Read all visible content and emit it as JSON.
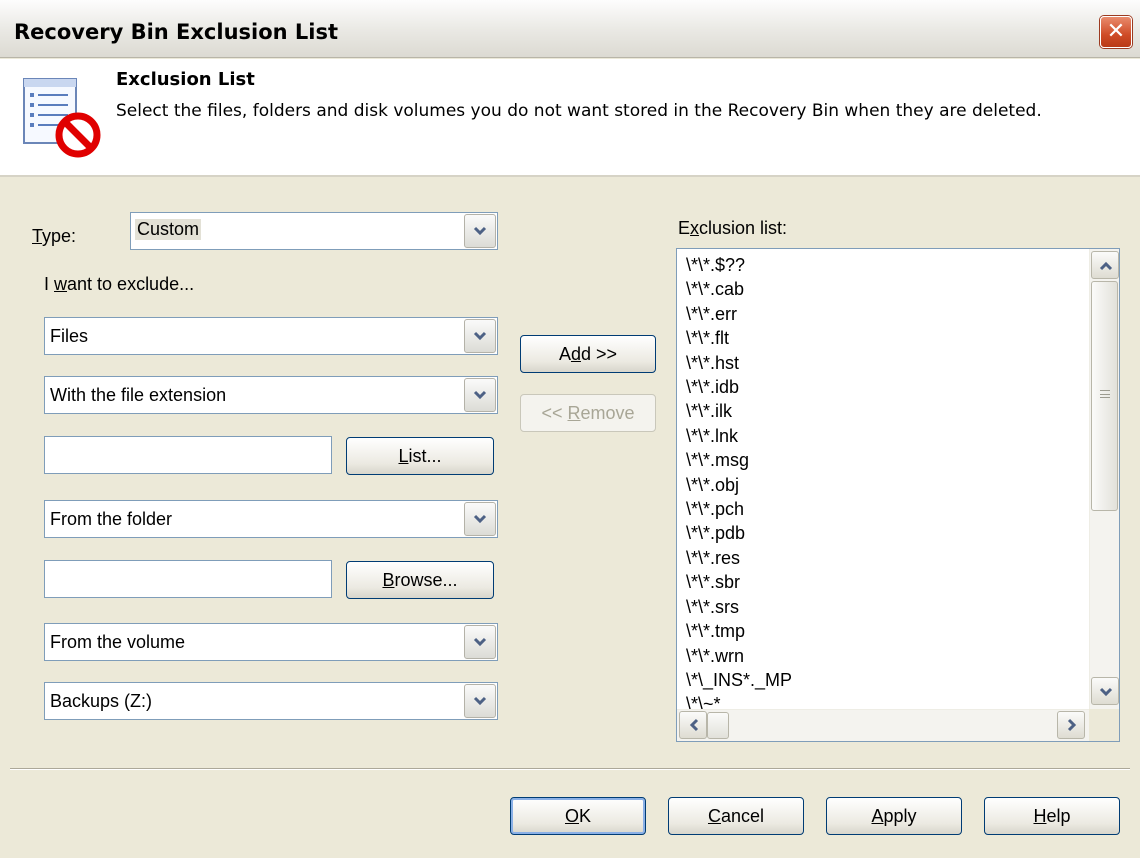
{
  "window": {
    "title": "Recovery Bin Exclusion List",
    "close_glyph": "✕"
  },
  "header": {
    "title": "Exclusion List",
    "description": "Select the files, folders and disk volumes you do not want stored in the Recovery Bin when they are deleted.",
    "icon": "exclusion-list-icon"
  },
  "form": {
    "type_label": "Type:",
    "type_value": "Custom",
    "exclude_label": "I want to exclude...",
    "what_value": "Files",
    "filter_value": "With the file extension",
    "extension_value": "",
    "list_button": "List...",
    "folder_mode_value": "From the folder",
    "folder_value": "",
    "browse_button": "Browse...",
    "volume_mode_value": "From the volume",
    "volume_value": "Backups (Z:)"
  },
  "actions": {
    "add_button": "Add >>",
    "remove_button": "<< Remove"
  },
  "exclusion": {
    "label": "Exclusion list:",
    "items": [
      "\\*\\*.$??",
      "\\*\\*.cab",
      "\\*\\*.err",
      "\\*\\*.flt",
      "\\*\\*.hst",
      "\\*\\*.idb",
      "\\*\\*.ilk",
      "\\*\\*.lnk",
      "\\*\\*.msg",
      "\\*\\*.obj",
      "\\*\\*.pch",
      "\\*\\*.pdb",
      "\\*\\*.res",
      "\\*\\*.sbr",
      "\\*\\*.srs",
      "\\*\\*.tmp",
      "\\*\\*.wrn",
      "\\*\\_INS*._MP",
      "\\*\\~*"
    ]
  },
  "footer": {
    "ok": "OK",
    "cancel": "Cancel",
    "apply": "Apply",
    "help": "Help"
  },
  "colors": {
    "face": "#ece9d8",
    "header_bg": "#ffffff",
    "field_border": "#7f9db9",
    "button_border": "#003c74",
    "close_red": "#cf4b26"
  }
}
